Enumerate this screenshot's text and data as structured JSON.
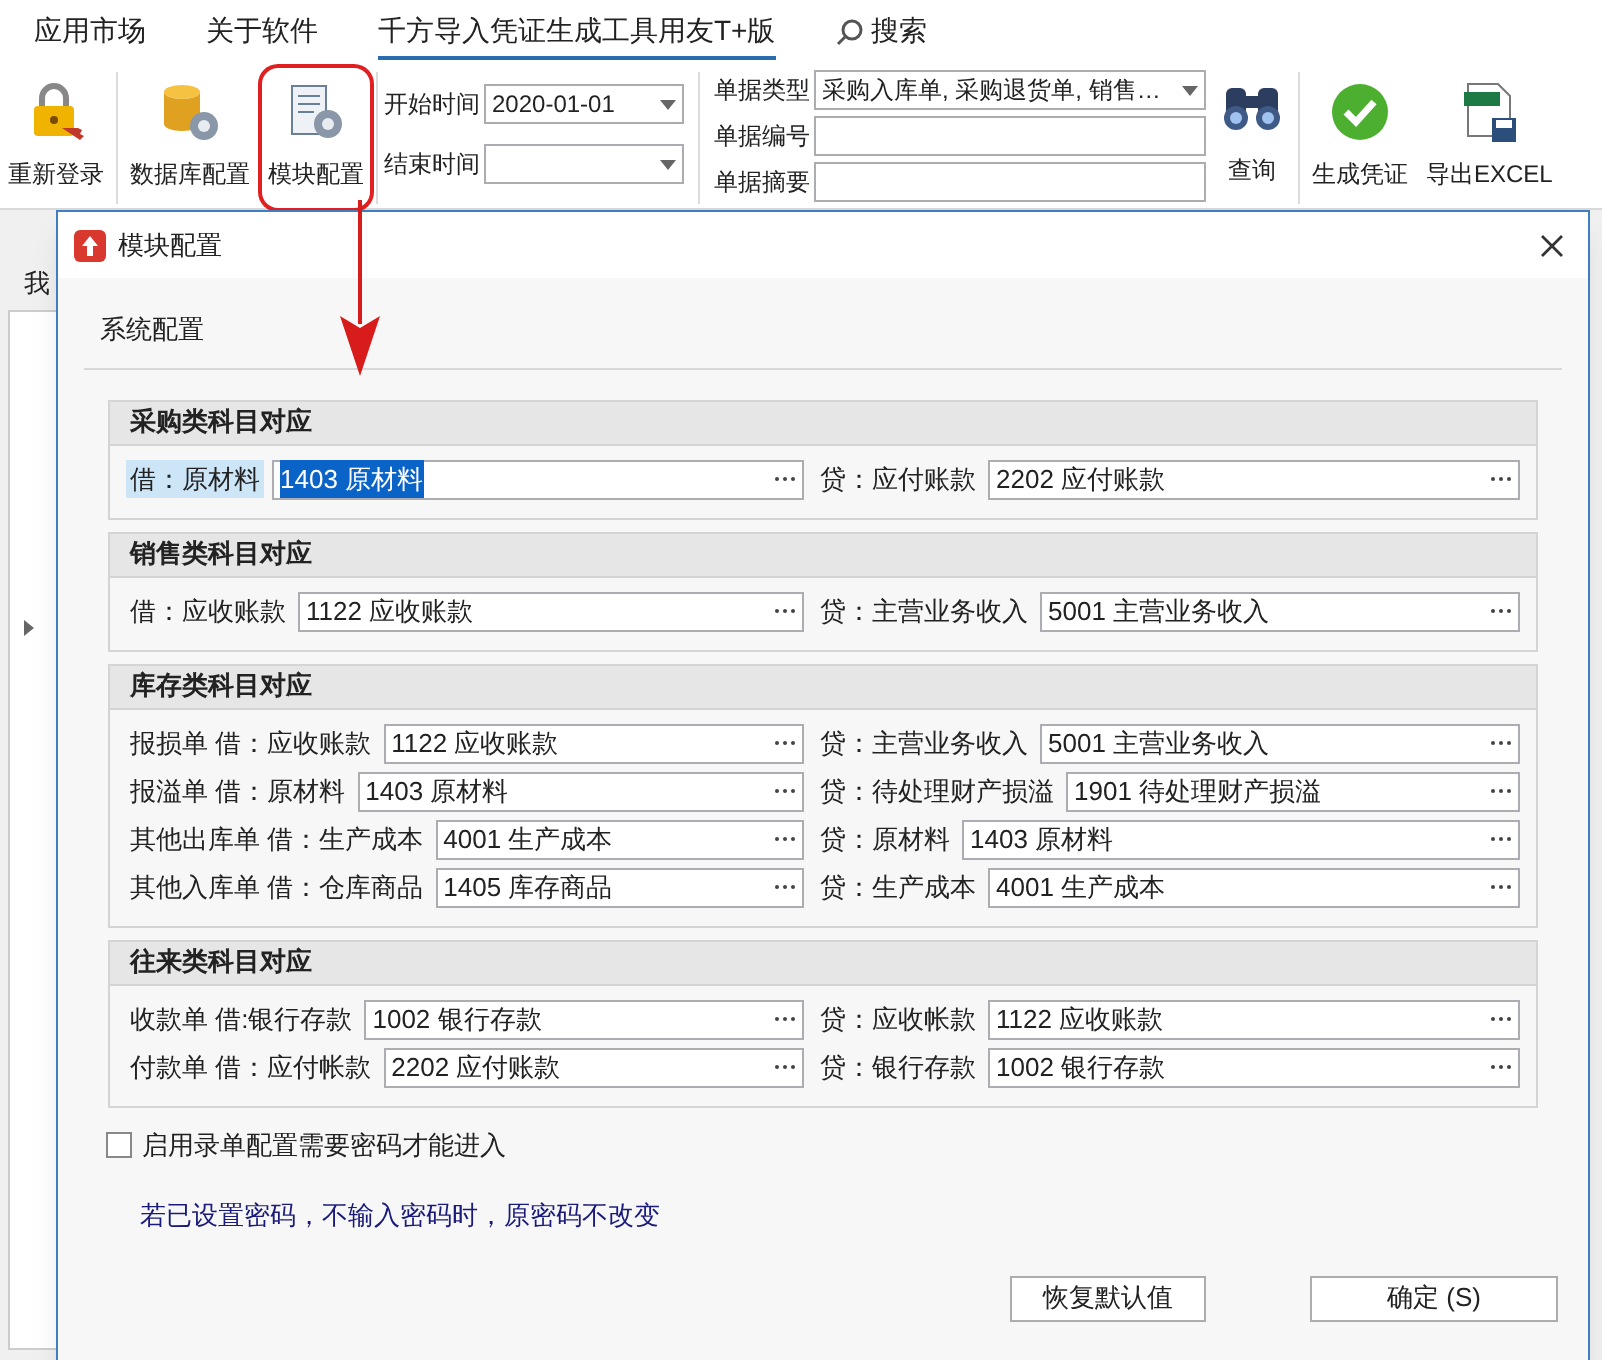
{
  "menu_tabs": [
    {
      "label": "应用市场",
      "selected": false
    },
    {
      "label": "关于软件",
      "selected": false
    },
    {
      "label": "千方导入凭证生成工具用友T+版",
      "selected": true
    }
  ],
  "search": {
    "label": "搜索"
  },
  "toolbar": {
    "left_buttons": [
      {
        "kind": "login",
        "label": "重新登录",
        "annotated": false
      },
      {
        "kind": "database",
        "label": "数据库配置",
        "annotated": false
      },
      {
        "kind": "module",
        "label": "模块配置",
        "annotated": true
      }
    ],
    "start_date": {
      "label": "开始时间",
      "value": "2020-01-01"
    },
    "end_date": {
      "label": "结束时间"
    },
    "doc_type": {
      "label": "单据类型",
      "value": "采购入库单, 采购退货单, 销售…"
    },
    "doc_number": {
      "label": "单据编号"
    },
    "doc_summary": {
      "label": "单据摘要"
    },
    "query_button": {
      "label": "查询"
    },
    "right_buttons": [
      {
        "kind": "voucher",
        "label": "生成凭证"
      },
      {
        "kind": "excel",
        "label": "导出EXCEL"
      }
    ]
  },
  "background": {
    "tab_fragment": "我"
  },
  "dialog": {
    "title": "模块配置",
    "tabs": [
      {
        "label": "系统配置",
        "selected": true
      }
    ],
    "groups": [
      {
        "title": "采购类科目对应",
        "rows": [
          {
            "debit_label": "借：原材料",
            "debit_value": "1403 原材料",
            "focused": true,
            "credit_label": "贷：应付账款",
            "credit_value": "2202 应付账款"
          }
        ]
      },
      {
        "title": "销售类科目对应",
        "rows": [
          {
            "debit_label": "借：应收账款",
            "debit_value": "1122 应收账款",
            "focused": false,
            "credit_label": "贷：主营业务收入",
            "credit_value": "5001 主营业务收入"
          }
        ]
      },
      {
        "title": "库存类科目对应",
        "rows": [
          {
            "debit_label": "报损单 借：应收账款",
            "debit_value": "1122 应收账款",
            "focused": false,
            "credit_label": "贷：主营业务收入",
            "credit_value": "5001 主营业务收入"
          },
          {
            "debit_label": "报溢单 借：原材料",
            "debit_value": "1403 原材料",
            "focused": false,
            "credit_label": "贷：待处理财产损溢",
            "credit_value": "1901 待处理财产损溢"
          },
          {
            "debit_label": "其他出库单 借：生产成本",
            "debit_value": "4001 生产成本",
            "focused": false,
            "credit_label": "贷：原材料",
            "credit_value": "1403 原材料"
          },
          {
            "debit_label": "其他入库单 借：仓库商品",
            "debit_value": "1405 库存商品",
            "focused": false,
            "credit_label": "贷：生产成本",
            "credit_value": "4001 生产成本"
          }
        ]
      },
      {
        "title": "往来类科目对应",
        "rows": [
          {
            "debit_label": "收款单 借:银行存款",
            "debit_value": "1002 银行存款",
            "focused": false,
            "credit_label": "贷：应收帐款",
            "credit_value": "1122 应收账款"
          },
          {
            "debit_label": "付款单 借：应付帐款",
            "debit_value": "2202 应付账款",
            "focused": false,
            "credit_label": "贷：银行存款",
            "credit_value": "1002 银行存款"
          }
        ]
      }
    ],
    "password_checkbox": {
      "label": "启用录单配置需要密码才能进入",
      "checked": false
    },
    "note": "若已设置密码，不输入密码时，原密码不改变",
    "buttons": [
      "恢复默认值",
      "确定 (S)"
    ]
  }
}
